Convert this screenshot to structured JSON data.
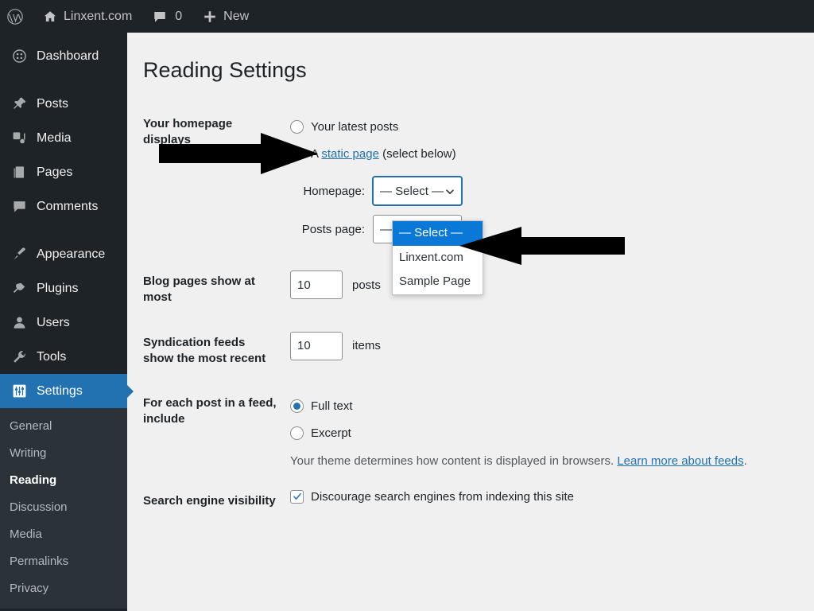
{
  "adminbar": {
    "items": [
      {
        "name": "wordpress-logo",
        "icon": "wordpress-icon",
        "label": ""
      },
      {
        "name": "site-name",
        "icon": "home-icon",
        "label": "Linxent.com"
      },
      {
        "name": "comments",
        "icon": "comment-icon",
        "label": "0"
      },
      {
        "name": "new-content",
        "icon": "plus-icon",
        "label": "New"
      }
    ]
  },
  "sidebar": {
    "items": [
      {
        "label": "Dashboard",
        "icon": "dashboard-icon"
      },
      {
        "label": "Posts",
        "icon": "pin-icon"
      },
      {
        "label": "Media",
        "icon": "media-icon"
      },
      {
        "label": "Pages",
        "icon": "page-icon"
      },
      {
        "label": "Comments",
        "icon": "comment-icon"
      },
      {
        "label": "Appearance",
        "icon": "brush-icon"
      },
      {
        "label": "Plugins",
        "icon": "plug-icon"
      },
      {
        "label": "Users",
        "icon": "user-icon"
      },
      {
        "label": "Tools",
        "icon": "wrench-icon"
      },
      {
        "label": "Settings",
        "icon": "settings-icon"
      }
    ],
    "submenu": [
      {
        "label": "General"
      },
      {
        "label": "Writing"
      },
      {
        "label": "Reading"
      },
      {
        "label": "Discussion"
      },
      {
        "label": "Media"
      },
      {
        "label": "Permalinks"
      },
      {
        "label": "Privacy"
      }
    ]
  },
  "page": {
    "title": "Reading Settings"
  },
  "homepage_displays": {
    "label": "Your homepage displays",
    "option_latest_posts": "Your latest posts",
    "option_static_prefix": "A ",
    "option_static_link": "static page",
    "option_static_suffix": " (select below)",
    "homepage_label": "Homepage:",
    "homepage_value": "— Select —",
    "posts_page_label": "Posts page:",
    "posts_page_value": "— Select —"
  },
  "dropdown": {
    "options": [
      {
        "label": "— Select —",
        "highlighted": true
      },
      {
        "label": "Linxent.com",
        "highlighted": false
      },
      {
        "label": "Sample Page",
        "highlighted": false
      }
    ]
  },
  "blog_pages": {
    "label": "Blog pages show at most",
    "value": "10",
    "unit": "posts"
  },
  "syndication": {
    "label": "Syndication feeds show the most recent",
    "value": "10",
    "unit": "items"
  },
  "feed_include": {
    "label": "For each post in a feed, include",
    "option_full_text": "Full text",
    "option_excerpt": "Excerpt",
    "description_prefix": "Your theme determines how content is displayed in browsers. ",
    "description_link": "Learn more about feeds",
    "description_suffix": "."
  },
  "search_visibility": {
    "label": "Search engine visibility",
    "checkbox_label": "Discourage search engines from indexing this site"
  },
  "colors": {
    "sidebar_bg": "#1d2327",
    "submenu_bg": "#2c3338",
    "accent_blue": "#2271b1",
    "highlight_blue": "#0a78d6",
    "content_bg": "#f0f0f1",
    "annotation": "#000000"
  }
}
